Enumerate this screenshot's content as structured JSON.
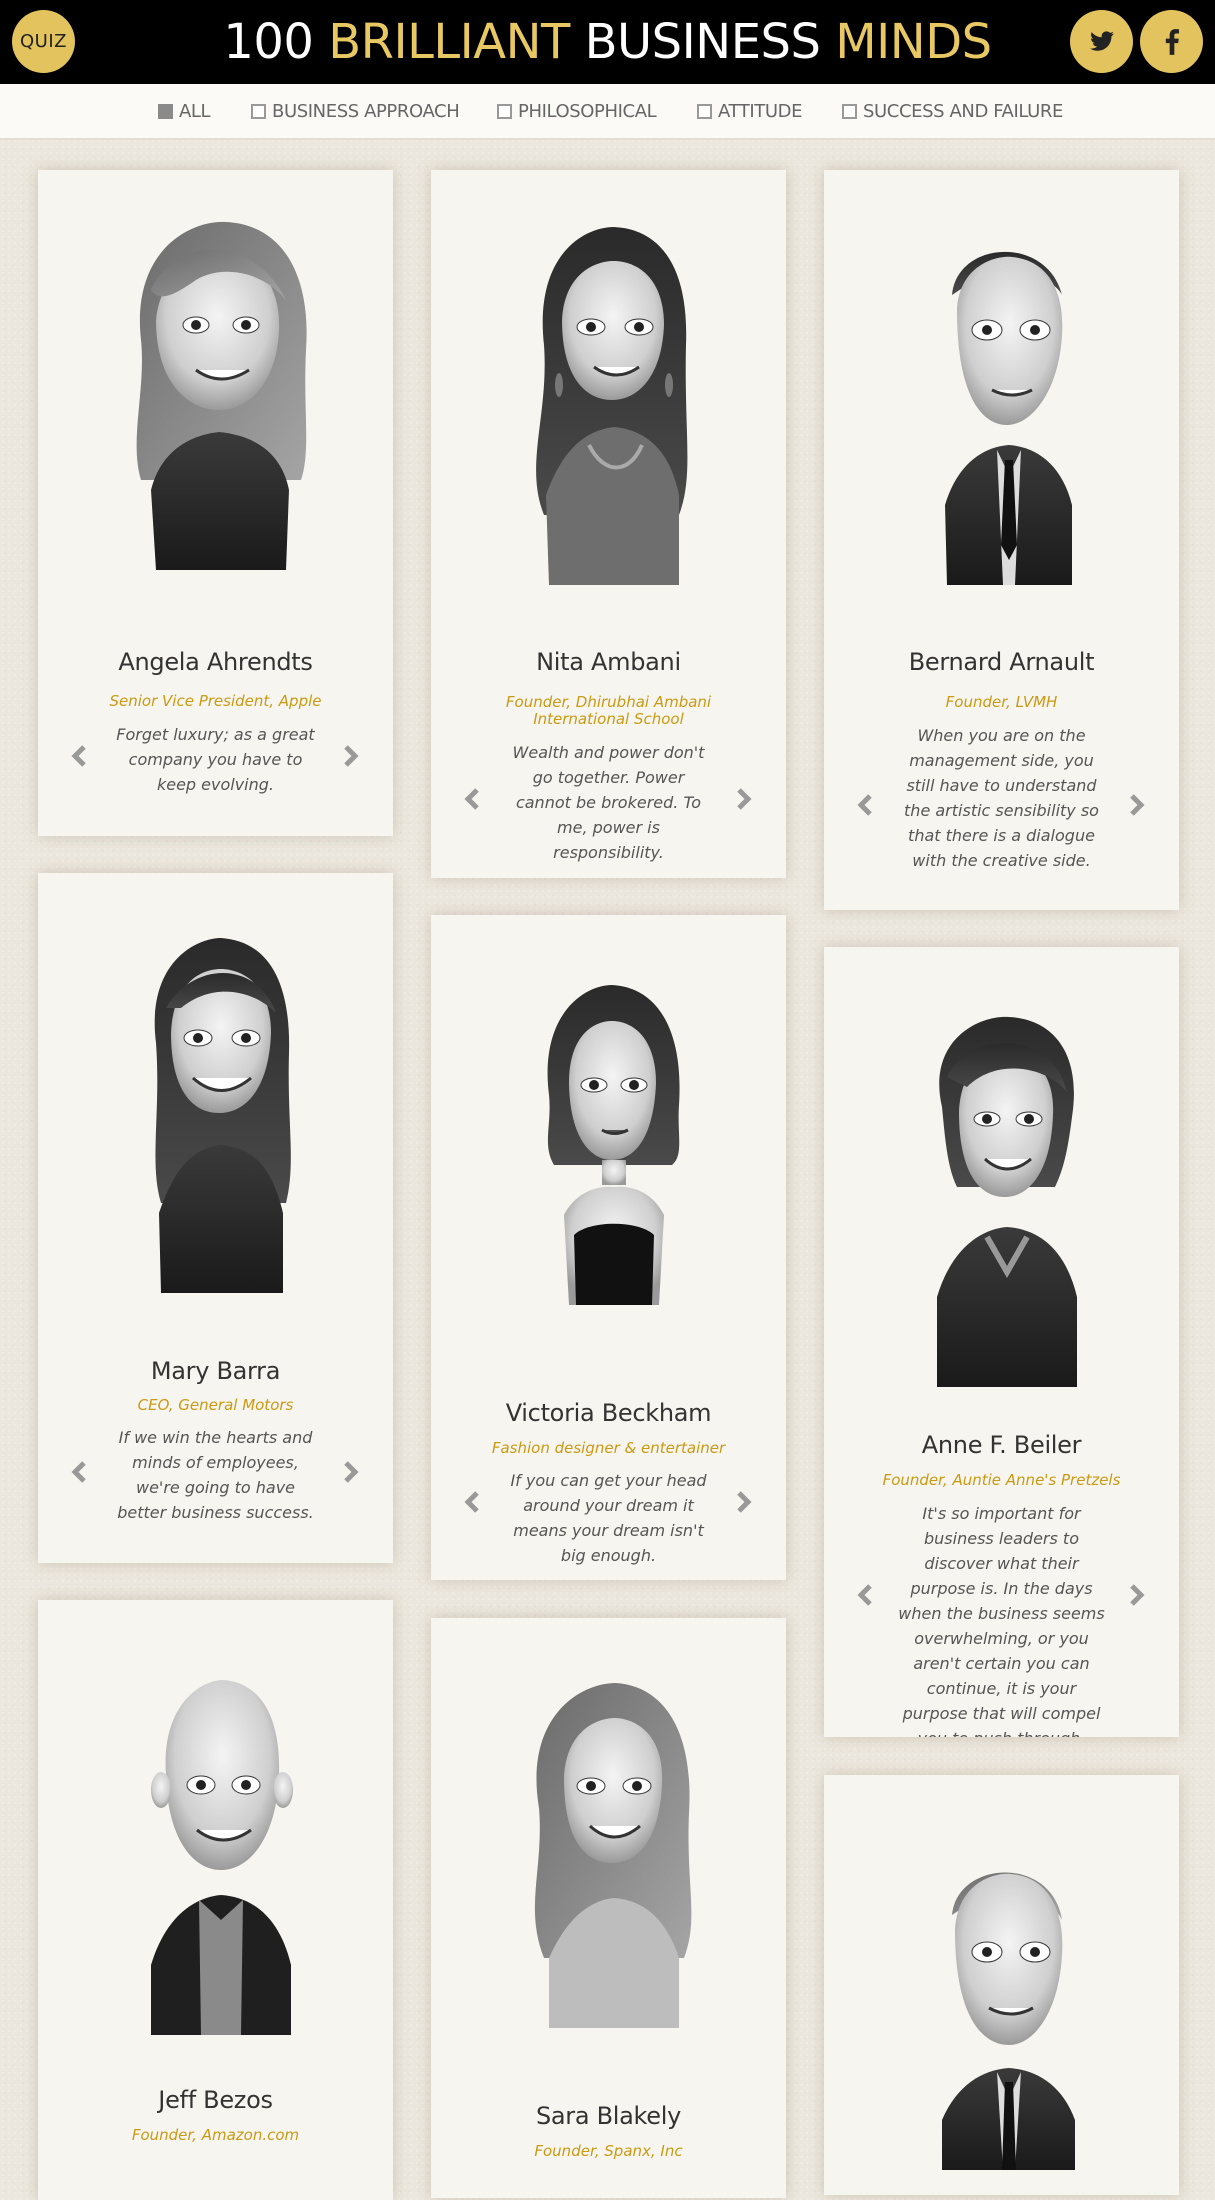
{
  "header": {
    "quiz_label": "QUIZ",
    "title_part1": "100 ",
    "title_part2": "BRILLIANT",
    "title_part3": " BUSINESS ",
    "title_part4": "MINDS"
  },
  "filters": [
    {
      "label": "ALL",
      "checked": true
    },
    {
      "label": "BUSINESS APPROACH",
      "checked": false
    },
    {
      "label": "PHILOSOPHICAL",
      "checked": false
    },
    {
      "label": "ATTITUDE",
      "checked": false
    },
    {
      "label": "SUCCESS AND FAILURE",
      "checked": false
    }
  ],
  "cards": [
    {
      "name": "Angela Ahrendts",
      "role": "Senior Vice President, Apple",
      "quote": "Forget luxury; as a great company you have to keep evolving."
    },
    {
      "name": "Nita Ambani",
      "role": "Founder, Dhirubhai Ambani International School",
      "quote": "Wealth and power don't go together. Power cannot be brokered. To me, power is responsibility."
    },
    {
      "name": "Bernard Arnault",
      "role": "Founder, LVMH",
      "quote": "When you are on the management side, you still have to understand the artistic sensibility so that there is a dialogue with the creative side."
    },
    {
      "name": "Mary Barra",
      "role": "CEO, General Motors",
      "quote": "If we win the hearts and minds of employees, we're going to have better business success."
    },
    {
      "name": "Victoria Beckham",
      "role": "Fashion designer & entertainer",
      "quote": "If you can get your head around your dream it means your dream isn't big enough."
    },
    {
      "name": "Anne F. Beiler",
      "role": "Founder, Auntie Anne's Pretzels",
      "quote": "It's so important for business leaders to discover what their purpose is. In the days when the business seems overwhelming, or you aren't certain you can continue, it is your purpose that will compel you to push through."
    },
    {
      "name": "Jeff Bezos",
      "role": "Founder, Amazon.com",
      "quote": ""
    },
    {
      "name": "Sara Blakely",
      "role": "Founder, Spanx, Inc",
      "quote": ""
    },
    {
      "name": "",
      "role": "",
      "quote": ""
    }
  ],
  "colors": {
    "accent": "#e8c862",
    "role_text": "#c99a12",
    "card_bg": "#f7f5f0",
    "topbar": "#000000"
  },
  "icons": {
    "quiz": "quiz-badge",
    "twitter": "twitter-icon",
    "facebook": "facebook-icon",
    "prev": "chevron-left-icon",
    "next": "chevron-right-icon"
  }
}
